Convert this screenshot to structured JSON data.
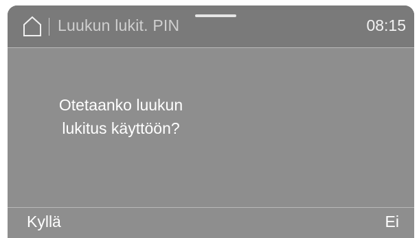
{
  "header": {
    "title": "Luukun lukit. PIN",
    "time": "08:15",
    "home_icon": "home-icon"
  },
  "dialog": {
    "line1": "Otetaanko luukun",
    "line2": "lukitus käyttöön?"
  },
  "softkeys": {
    "left_label": "Kyllä",
    "right_label": "Ei"
  },
  "colors": {
    "screen_bg": "#8e8e8e",
    "header_bg": "#7a7a7a",
    "text_primary": "#ffffff",
    "text_dimmed": "#cfcfcf",
    "rule": "#b8b8b8"
  }
}
